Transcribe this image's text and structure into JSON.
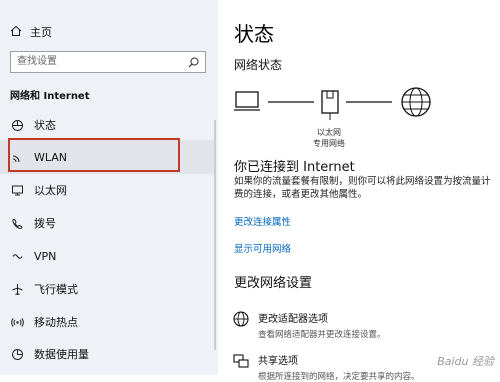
{
  "sidebar": {
    "home_label": "主页",
    "search_placeholder": "查找设置",
    "section_title": "网络和 Internet",
    "items": [
      {
        "label": "状态",
        "icon": "home-globe-icon"
      },
      {
        "label": "WLAN",
        "icon": "wifi-icon"
      },
      {
        "label": "以太网",
        "icon": "ethernet-icon"
      },
      {
        "label": "拨号",
        "icon": "dialup-icon"
      },
      {
        "label": "VPN",
        "icon": "vpn-icon"
      },
      {
        "label": "飞行模式",
        "icon": "airplane-icon"
      },
      {
        "label": "移动热点",
        "icon": "hotspot-icon"
      },
      {
        "label": "数据使用量",
        "icon": "data-usage-icon"
      }
    ]
  },
  "main": {
    "title": "状态",
    "network_status_heading": "网络状态",
    "adapter_label_1": "以太网",
    "adapter_label_2": "专用网络",
    "connected_text": "你已连接到 Internet",
    "description": "如果你的流量套餐有限制，则你可以将此网络设置为按流量计费的连接，或者更改其他属性。",
    "link_change_properties": "更改连接属性",
    "link_show_networks": "显示可用网络",
    "change_settings_heading": "更改网络设置",
    "options": [
      {
        "title": "更改适配器选项",
        "desc": "查看网络适配器并更改连接设置。"
      },
      {
        "title": "共享选项",
        "desc": "根据所连接到的网络，决定要共享的内容。"
      }
    ]
  },
  "watermark": "Baidu 经验",
  "colors": {
    "accent_link": "#0067c0",
    "highlight_border": "#c0392b",
    "sidebar_bg": "#eef1f5"
  }
}
